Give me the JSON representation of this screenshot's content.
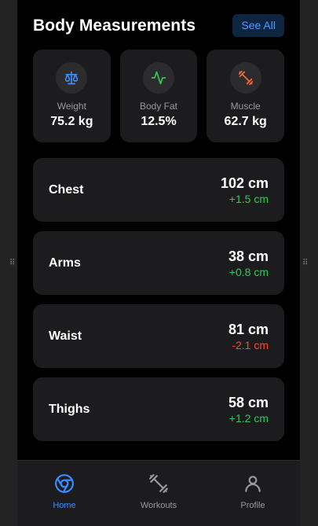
{
  "header": {
    "title": "Body Measurements",
    "see_all_label": "See All"
  },
  "stats": [
    {
      "label": "Weight",
      "value": "75.2 kg",
      "icon": "scale-icon",
      "icon_color": "#3b8cff"
    },
    {
      "label": "Body Fat",
      "value": "12.5%",
      "icon": "activity-icon",
      "icon_color": "#34c759"
    },
    {
      "label": "Muscle",
      "value": "62.7 kg",
      "icon": "dumbbell-icon",
      "icon_color": "#ff6b35"
    }
  ],
  "measurements": [
    {
      "name": "Chest",
      "value": "102 cm",
      "delta": "+1.5 cm",
      "trend": "positive"
    },
    {
      "name": "Arms",
      "value": "38 cm",
      "delta": "+0.8 cm",
      "trend": "positive"
    },
    {
      "name": "Waist",
      "value": "81 cm",
      "delta": "-2.1 cm",
      "trend": "negative"
    },
    {
      "name": "Thighs",
      "value": "58 cm",
      "delta": "+1.2 cm",
      "trend": "positive"
    }
  ],
  "tabbar": {
    "items": [
      {
        "label": "Home",
        "icon": "chrome-icon",
        "active": true
      },
      {
        "label": "Workouts",
        "icon": "dumbbell-icon",
        "active": false
      },
      {
        "label": "Profile",
        "icon": "user-icon",
        "active": false
      }
    ]
  },
  "colors": {
    "accent": "#3b8cff",
    "positive": "#34c759",
    "negative": "#ff453a",
    "card": "#1c1c1e",
    "background": "#000000"
  }
}
